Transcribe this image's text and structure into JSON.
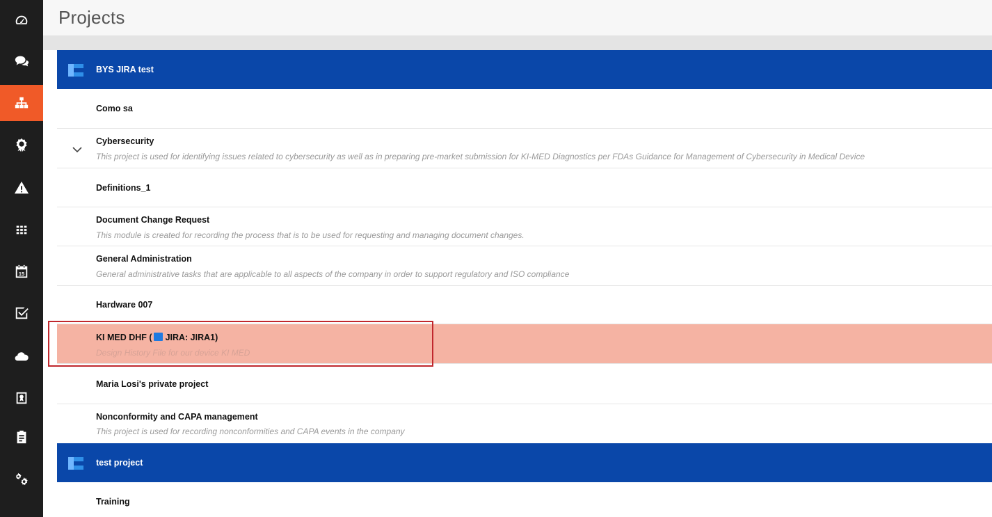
{
  "page": {
    "title": "Projects"
  },
  "colors": {
    "sidebar": "#1e1e1e",
    "active_nav": "#f05a28",
    "group_header": "#0a47a9",
    "highlight_row": "#f5b3a3",
    "selection_border": "#c0272d"
  },
  "sidebar": {
    "items": [
      {
        "icon": "dashboard-icon",
        "active": false
      },
      {
        "icon": "chat-icon",
        "active": false
      },
      {
        "icon": "sitemap-icon",
        "active": true
      },
      {
        "icon": "award-icon",
        "active": false
      },
      {
        "icon": "warning-icon",
        "active": false
      },
      {
        "icon": "grid-icon",
        "active": false
      },
      {
        "icon": "calendar-icon",
        "active": false
      },
      {
        "icon": "checkbox-icon",
        "active": false
      },
      {
        "icon": "cloud-icon",
        "active": false
      },
      {
        "icon": "badge-icon",
        "active": false
      },
      {
        "icon": "clipboard-icon",
        "active": false
      },
      {
        "icon": "settings-icon",
        "active": false
      }
    ],
    "calendar_day": "15"
  },
  "groups": [
    {
      "title": "BYS JIRA test",
      "projects": [
        {
          "name": "Como sa",
          "description": ""
        },
        {
          "name": "Cybersecurity",
          "description": "This project is used for identifying issues related to cybersecurity as well as in preparing pre-market submission for KI-MED Diagnostics per FDAs Guidance for Management of Cybersecurity in Medical Device",
          "expanded": true
        },
        {
          "name": "Definitions_1",
          "description": ""
        },
        {
          "name": "Document Change Request",
          "description": "This module is created for recording the process that is to be used for requesting and managing document changes."
        },
        {
          "name": "General Administration",
          "description": "General administrative tasks that are applicable to all aspects of the company in order to support regulatory and ISO compliance"
        },
        {
          "name": "Hardware 007",
          "description": ""
        },
        {
          "name": "KI MED DHF (",
          "jira": "JIRA: JIRA1)",
          "description": "Design History File for our device KI MED",
          "selected": true
        },
        {
          "name": "Maria Losi's private project",
          "description": ""
        },
        {
          "name": "Nonconformity and CAPA management",
          "description": "This project is used for recording nonconformities and CAPA events in the company"
        }
      ]
    },
    {
      "title": "test project",
      "projects": [
        {
          "name": "Training",
          "description": ""
        }
      ]
    }
  ]
}
